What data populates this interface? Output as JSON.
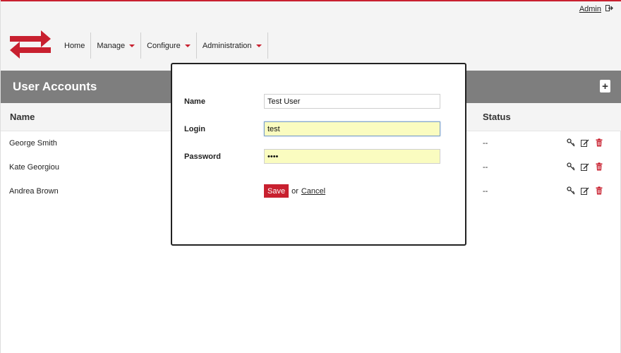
{
  "header": {
    "user_link": "Admin",
    "nav": [
      {
        "label": "Home",
        "has_menu": false
      },
      {
        "label": "Manage",
        "has_menu": true
      },
      {
        "label": "Configure",
        "has_menu": true
      },
      {
        "label": "Administration",
        "has_menu": true
      }
    ]
  },
  "section": {
    "title": "User Accounts"
  },
  "table": {
    "columns": [
      "Name",
      "Status"
    ],
    "rows": [
      {
        "name": "George Smith",
        "status": "--"
      },
      {
        "name": "Kate Georgiou",
        "status": "--"
      },
      {
        "name": "Andrea Brown",
        "status": "--"
      }
    ]
  },
  "modal": {
    "name_label": "Name",
    "name_value": "Test User",
    "login_label": "Login",
    "login_value": "test",
    "password_label": "Password",
    "password_value": "test",
    "save_label": "Save",
    "or_text": "or",
    "cancel_label": "Cancel"
  },
  "colors": {
    "brand": "#c8202f",
    "section_bg": "#7e7e7e",
    "highlight_input": "#fafcc0"
  },
  "icons": [
    "logout-icon",
    "swap-arrows-logo",
    "plus-icon",
    "key-icon",
    "edit-icon",
    "trash-icon"
  ]
}
